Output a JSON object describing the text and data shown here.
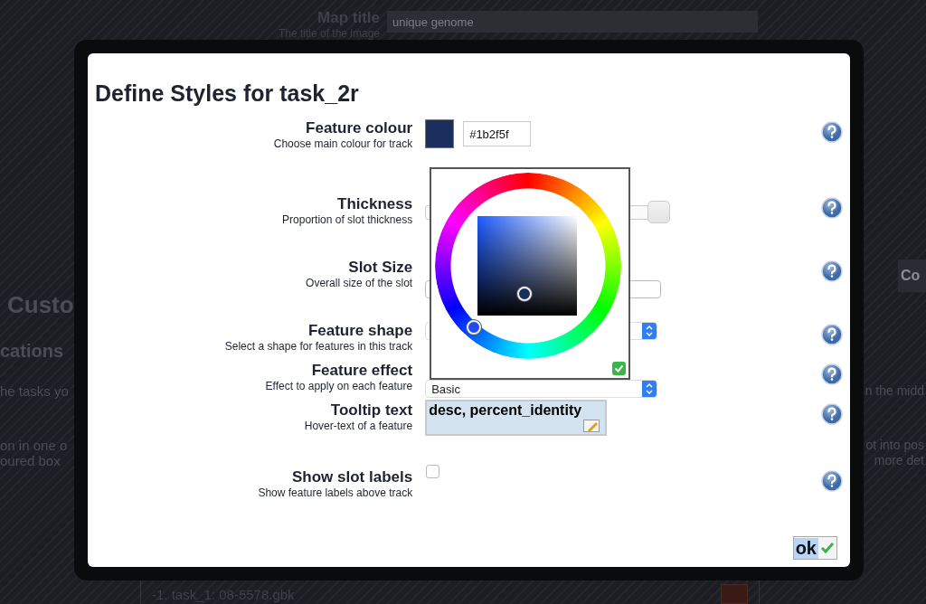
{
  "background": {
    "map_title": {
      "label": "Map title",
      "hint": "The title of the image",
      "value": "unique genome"
    },
    "heading": "Custo",
    "subheading": "cations",
    "left_lines": [
      "he tasks yo",
      "on in one o",
      "oured box"
    ],
    "right_button": "Co",
    "right_lines": [
      "n the midd",
      "ot into pos",
      "more det"
    ],
    "task_row": {
      "label": "-1.  task_1: 08-5578.gbk",
      "color": "#3a1a14"
    }
  },
  "dialog": {
    "title": "Define Styles for task_2r",
    "rows": [
      {
        "kind": "colour",
        "title": "Feature colour",
        "hint": "Choose main colour for track",
        "value": "#1b2f5f",
        "color": "#1b2f5f"
      },
      {
        "kind": "slider",
        "title": "Thickness",
        "hint": "Proportion of slot thickness",
        "level": 1
      },
      {
        "kind": "input",
        "title": "Slot Size",
        "hint": "Overall size of the slot"
      },
      {
        "kind": "select",
        "title": "Feature shape",
        "hint": "Select a shape for features in this track"
      },
      {
        "kind": "select",
        "title": "Feature effect",
        "hint": "Effect to apply on each feature",
        "value": "Basic"
      },
      {
        "kind": "textarea",
        "title": "Tooltip text",
        "hint": "Hover-text of a feature",
        "value": "desc, percent_identity"
      },
      {
        "kind": "checkbox",
        "title": "Show slot labels",
        "hint": "Show feature labels above track",
        "checked": false
      }
    ],
    "ok": "ok"
  },
  "color_picker": {
    "open": true
  }
}
